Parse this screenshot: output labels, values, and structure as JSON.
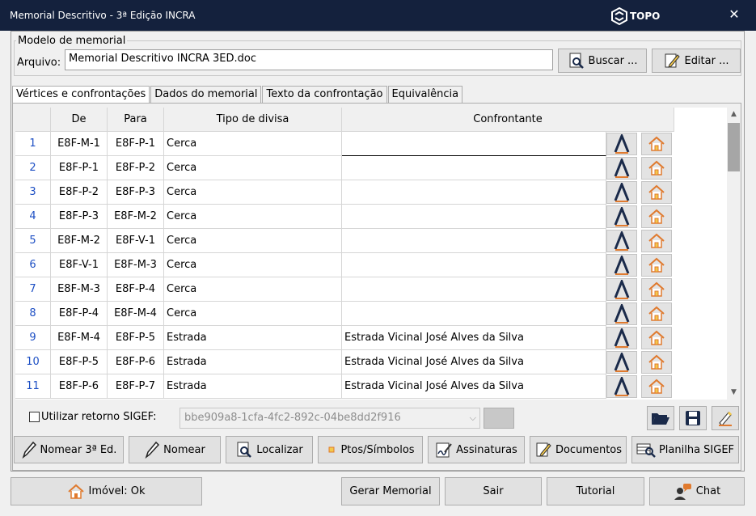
{
  "window": {
    "title": "Memorial Descritivo - 3ª Edição INCRA",
    "brand": "TOPO",
    "close_glyph": "✕"
  },
  "modelo": {
    "legend": "Modelo de memorial",
    "arquivo_label": "Arquivo:",
    "arquivo_value": "Memorial Descritivo INCRA 3ED.doc",
    "buscar_label": "Buscar ...",
    "editar_label": "Editar ..."
  },
  "tabs": [
    {
      "label": "Vértices e confrontações",
      "active": true
    },
    {
      "label": "Dados do memorial",
      "active": false
    },
    {
      "label": "Texto da confrontação",
      "active": false
    },
    {
      "label": "Equivalência",
      "active": false
    }
  ],
  "grid": {
    "columns": [
      "De",
      "Para",
      "Tipo de divisa",
      "Confrontante"
    ],
    "rows": [
      {
        "n": "1",
        "de": "E8F-M-1",
        "para": "E8F-P-1",
        "tipo": "Cerca",
        "confrontante": ""
      },
      {
        "n": "2",
        "de": "E8F-P-1",
        "para": "E8F-P-2",
        "tipo": "Cerca",
        "confrontante": ""
      },
      {
        "n": "3",
        "de": "E8F-P-2",
        "para": "E8F-P-3",
        "tipo": "Cerca",
        "confrontante": ""
      },
      {
        "n": "4",
        "de": "E8F-P-3",
        "para": "E8F-M-2",
        "tipo": "Cerca",
        "confrontante": ""
      },
      {
        "n": "5",
        "de": "E8F-M-2",
        "para": "E8F-V-1",
        "tipo": "Cerca",
        "confrontante": ""
      },
      {
        "n": "6",
        "de": "E8F-V-1",
        "para": "E8F-M-3",
        "tipo": "Cerca",
        "confrontante": ""
      },
      {
        "n": "7",
        "de": "E8F-M-3",
        "para": "E8F-P-4",
        "tipo": "Cerca",
        "confrontante": ""
      },
      {
        "n": "8",
        "de": "E8F-P-4",
        "para": "E8F-M-4",
        "tipo": "Cerca",
        "confrontante": ""
      },
      {
        "n": "9",
        "de": "E8F-M-4",
        "para": "E8F-P-5",
        "tipo": "Estrada",
        "confrontante": "Estrada Vicinal José Alves da Silva"
      },
      {
        "n": "10",
        "de": "E8F-P-5",
        "para": "E8F-P-6",
        "tipo": "Estrada",
        "confrontante": "Estrada Vicinal José Alves da Silva"
      },
      {
        "n": "11",
        "de": "E8F-P-6",
        "para": "E8F-P-7",
        "tipo": "Estrada",
        "confrontante": "Estrada Vicinal José Alves da Silva"
      }
    ]
  },
  "sigef": {
    "checkbox_label": "Utilizar retorno SIGEF:",
    "checked": false,
    "combo_value": "bbe909a8-1cfa-4fc2-892c-04be8dd2f916"
  },
  "actions": {
    "nomear3": "Nomear 3ª Ed.",
    "nomear": "Nomear",
    "localizar": "Localizar",
    "ptos": "Ptos/Símbolos",
    "assinaturas": "Assinaturas",
    "documentos": "Documentos",
    "planilha": "Planilha SIGEF"
  },
  "footer": {
    "imovel": "Imóvel: Ok",
    "gerar": "Gerar Memorial",
    "sair": "Sair",
    "tutorial": "Tutorial",
    "chat": "Chat"
  },
  "colors": {
    "titlebar": "#14213d",
    "row_number": "#1d4fc4",
    "home_icon": "#e07a2e",
    "icon_a": "#1a2a4a"
  }
}
